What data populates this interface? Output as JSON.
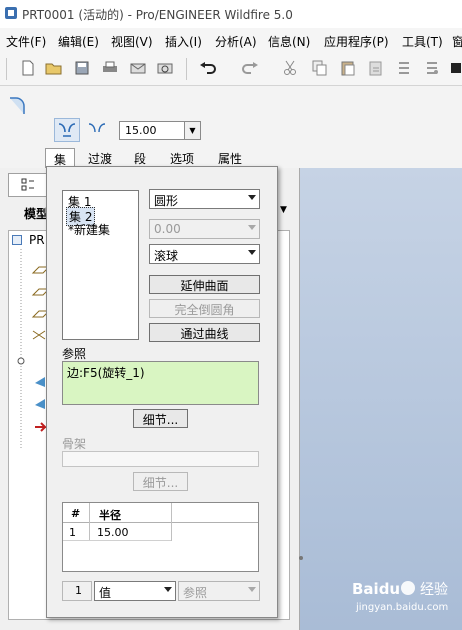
{
  "window": {
    "title": "PRT0001 (活动的) - Pro/ENGINEER Wildfire 5.0"
  },
  "menu": [
    {
      "label": "文件(F)"
    },
    {
      "label": "编辑(E)"
    },
    {
      "label": "视图(V)"
    },
    {
      "label": "插入(I)"
    },
    {
      "label": "分析(A)"
    },
    {
      "label": "信息(N)"
    },
    {
      "label": "应用程序(P)"
    },
    {
      "label": "工具(T)"
    },
    {
      "label": "窗"
    }
  ],
  "dashboard": {
    "radius_value": "15.00",
    "tabs": [
      {
        "label": "集"
      },
      {
        "label": "过渡"
      },
      {
        "label": "段"
      },
      {
        "label": "选项"
      },
      {
        "label": "属性"
      }
    ]
  },
  "left_panel": {
    "model_tree_label": "模型",
    "root_item": "PR"
  },
  "sets_panel": {
    "sets": [
      {
        "label": "集 1"
      },
      {
        "label": "集 2"
      },
      {
        "label": "*新建集"
      }
    ],
    "selected_set_index": 1,
    "cross_section": "圆形",
    "disabled_value": "0.00",
    "method": "滚球",
    "extend_surfaces_button": "延伸曲面",
    "full_round_button": "完全倒圆角",
    "through_curve_button": "通过曲线",
    "references_label": "参照",
    "reference_item": "边:F5(旋转_1)",
    "details_button": "细节...",
    "skeleton_label": "骨架",
    "skeleton_details_button": "细节...",
    "radius_table": {
      "columns": [
        "#",
        "半径"
      ],
      "rows": [
        {
          "index": "1",
          "radius": "15.00"
        }
      ]
    },
    "bottom_row": {
      "index": "1",
      "value_type": "值",
      "reference": "参照"
    }
  },
  "watermark": {
    "brand": "Baidu",
    "label": "经验",
    "url": "jingyan.baidu.com"
  }
}
